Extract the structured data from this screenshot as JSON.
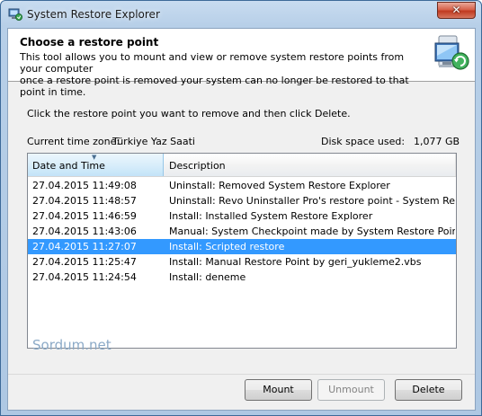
{
  "window": {
    "title": "System Restore Explorer",
    "close_glyph": "✕"
  },
  "header": {
    "title": "Choose a restore point",
    "description_line1": "This tool allows you to mount and view or remove system restore points from your computer",
    "description_line2": "once a restore point is removed your system can no longer be restored to that point in time.",
    "icon": "system-restore-computer-icon"
  },
  "instruction": "Click the restore point you want to remove and then click Delete.",
  "timezone": {
    "label": "Current time zone:",
    "value": "Türkiye Yaz Saati"
  },
  "disk": {
    "label": "Disk space used:",
    "value": "1,077 GB"
  },
  "list": {
    "columns": {
      "date": "Date and Time",
      "description": "Description"
    },
    "rows": [
      {
        "date": "27.04.2015 11:49:08",
        "description": "Uninstall: Removed System Restore Explorer"
      },
      {
        "date": "27.04.2015 11:48:57",
        "description": "Uninstall: Revo Uninstaller Pro's restore point - System Restore Ex"
      },
      {
        "date": "27.04.2015 11:46:59",
        "description": "Install: Installed System Restore Explorer"
      },
      {
        "date": "27.04.2015 11:43:06",
        "description": "Manual: System Checkpoint made by System Restore Point Creatc"
      },
      {
        "date": "27.04.2015 11:27:07",
        "description": "Install: Scripted restore",
        "selected": true
      },
      {
        "date": "27.04.2015 11:25:47",
        "description": "Install: Manual Restore Point by geri_yukleme2.vbs"
      },
      {
        "date": "27.04.2015 11:24:54",
        "description": "Install: deneme"
      }
    ]
  },
  "watermark": "Sordum.net",
  "buttons": {
    "mount": "Mount",
    "unmount": "Unmount",
    "delete": "Delete"
  },
  "colors": {
    "selection": "#3399ff",
    "title_bar": "#b7cfe8"
  }
}
